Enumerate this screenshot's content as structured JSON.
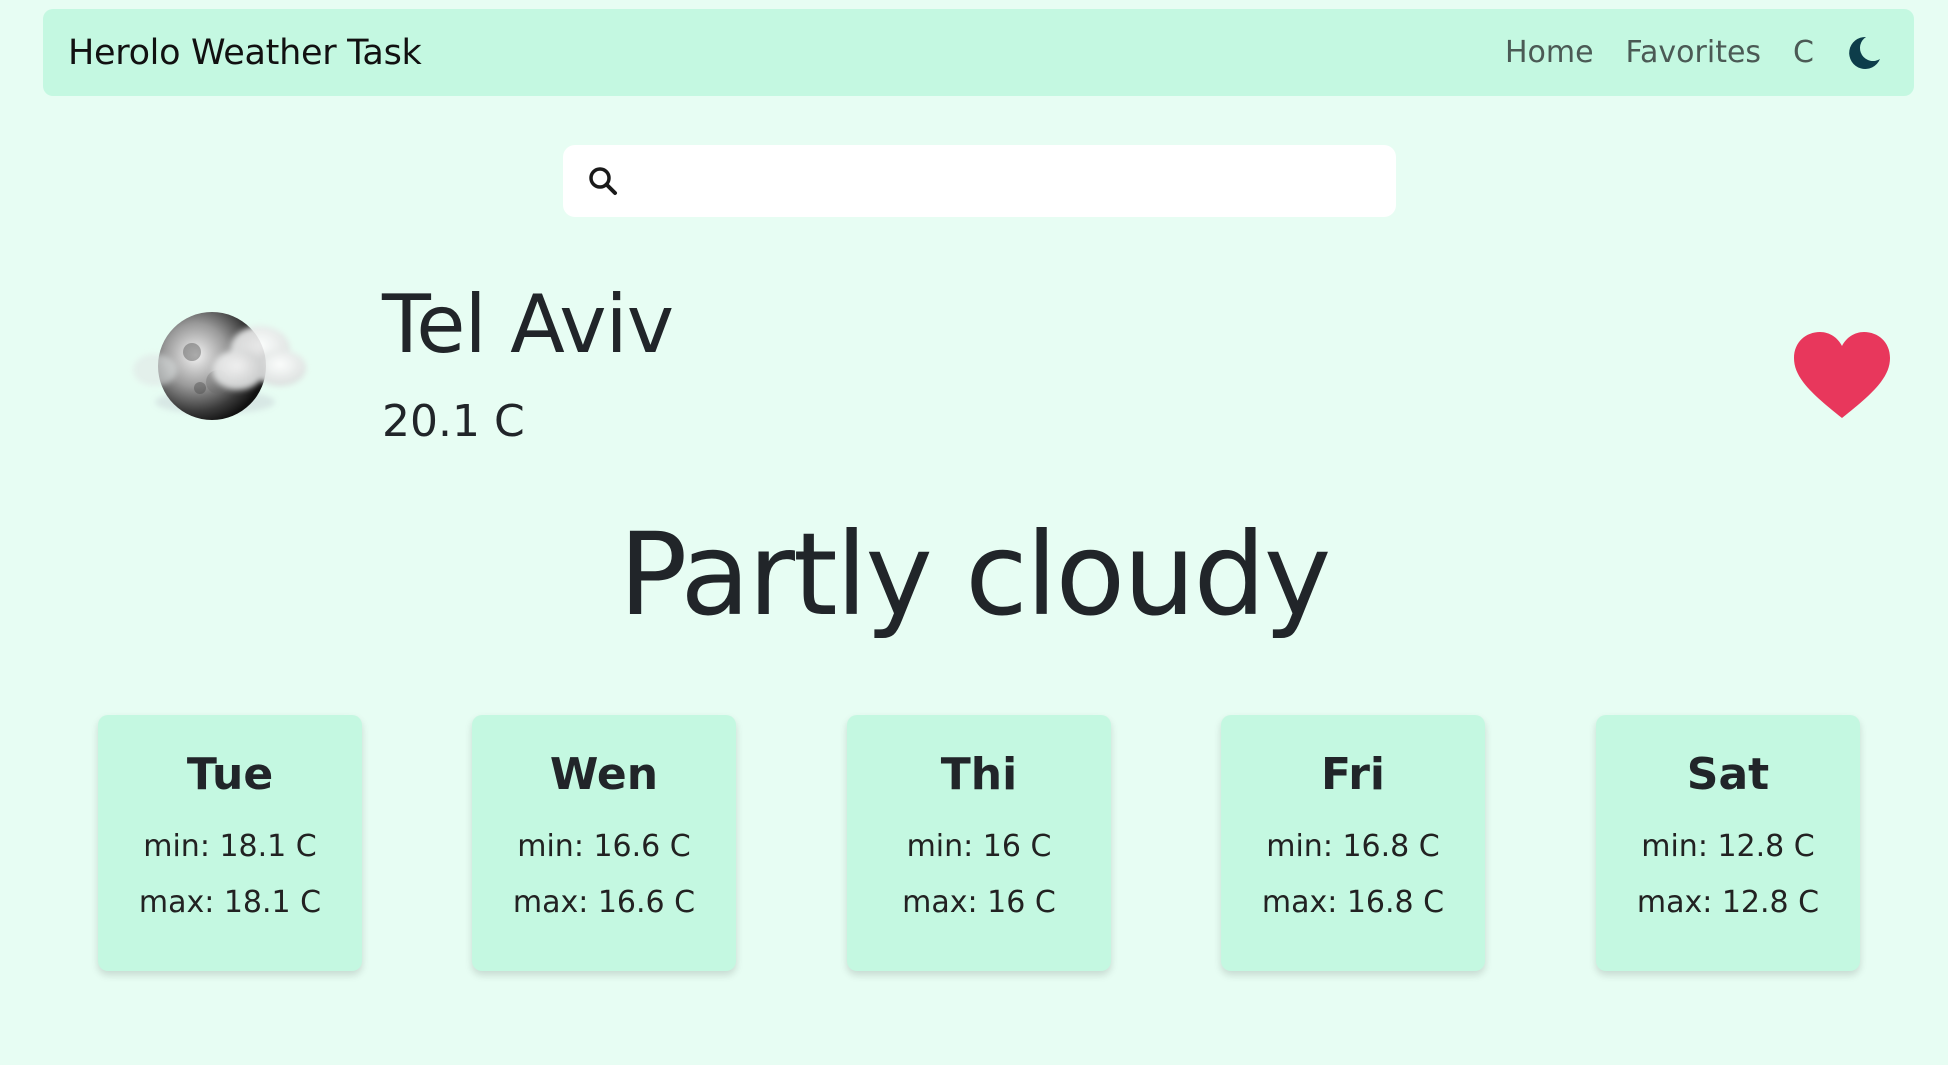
{
  "colors": {
    "page_background": "#e7fdf3",
    "navbar_background": "#c4f8e1",
    "card_background": "#c4f8e1",
    "heart": "#e8375c",
    "moon": "#0d3d4a",
    "text": "#212529"
  },
  "navbar": {
    "brand": "Herolo Weather Task",
    "links": [
      {
        "label": "Home"
      },
      {
        "label": "Favorites"
      },
      {
        "label": "C"
      }
    ],
    "theme_toggle_icon": "moon-icon"
  },
  "search": {
    "icon": "search-icon",
    "value": "",
    "placeholder": ""
  },
  "current": {
    "icon": "partly-cloudy-night-icon",
    "city": "Tel Aviv",
    "temperature": "20.1 C",
    "condition": "Partly cloudy",
    "favorite": true,
    "favorite_icon": "heart-icon"
  },
  "forecast": [
    {
      "day": "Tue",
      "min": "min: 18.1 C",
      "max": "max: 18.1 C"
    },
    {
      "day": "Wen",
      "min": "min: 16.6 C",
      "max": "max: 16.6 C"
    },
    {
      "day": "Thi",
      "min": "min: 16 C",
      "max": "max: 16 C"
    },
    {
      "day": "Fri",
      "min": "min: 16.8 C",
      "max": "max: 16.8 C"
    },
    {
      "day": "Sat",
      "min": "min: 12.8 C",
      "max": "max: 12.8 C"
    }
  ]
}
